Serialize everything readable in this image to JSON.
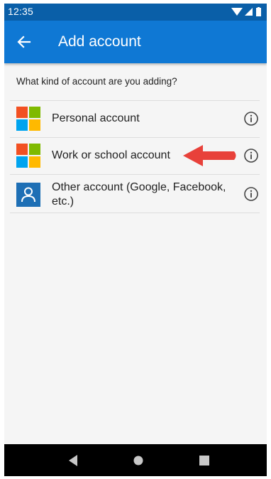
{
  "status_bar": {
    "time": "12:35",
    "icons": [
      "wifi-icon",
      "cell-signal-icon",
      "battery-icon"
    ]
  },
  "app_bar": {
    "title": "Add account",
    "back_icon": "arrow-left-icon"
  },
  "prompt": "What kind of account are you adding?",
  "accounts": [
    {
      "label": "Personal account",
      "icon": "microsoft-logo-icon"
    },
    {
      "label": "Work or school account",
      "icon": "microsoft-logo-icon",
      "highlighted": true
    },
    {
      "label": "Other account (Google, Facebook, etc.)",
      "icon": "person-icon"
    }
  ],
  "nav_bar": {
    "buttons": [
      "back-triangle-icon",
      "home-circle-icon",
      "recents-square-icon"
    ]
  },
  "colors": {
    "status_bar": "#0a5fa8",
    "app_bar": "#0f78d4",
    "annotation_arrow": "#e8413a",
    "ms_red": "#f25022",
    "ms_green": "#7fba00",
    "ms_blue": "#00a4ef",
    "ms_yellow": "#ffb900"
  }
}
